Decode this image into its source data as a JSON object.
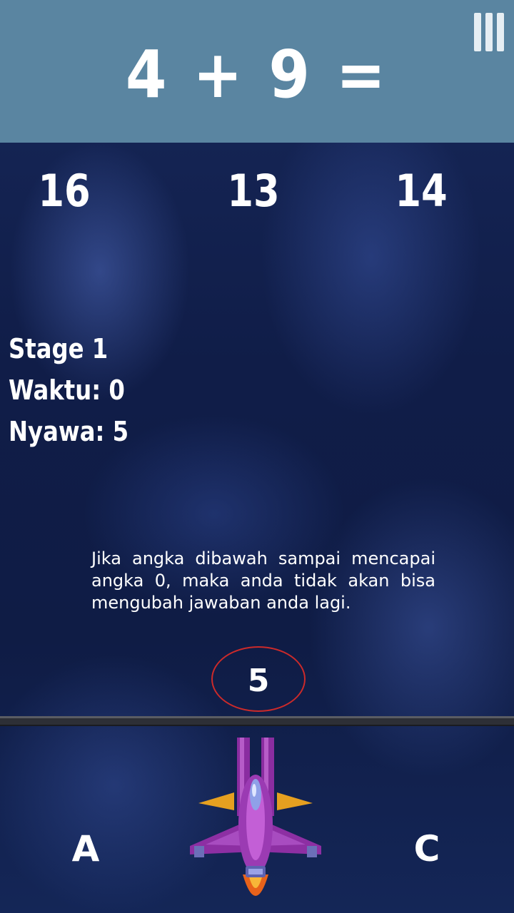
{
  "header": {
    "equation": "4 + 9 =",
    "menu_icon": "menu-bars-icon",
    "background_color": "#5a85a1"
  },
  "answers": [
    "16",
    "13",
    "14"
  ],
  "stats": {
    "stage": "Stage 1",
    "time": "Waktu: 0",
    "lives": "Nyawa: 5"
  },
  "info_text": "Jika angka dibawah sampai mencapai angka 0, maka anda tidak akan bisa mengubah jawaban anda lagi.",
  "countdown": "5",
  "lanes": {
    "left": "A",
    "right": "C"
  },
  "player": {
    "icon": "spaceship-icon"
  }
}
